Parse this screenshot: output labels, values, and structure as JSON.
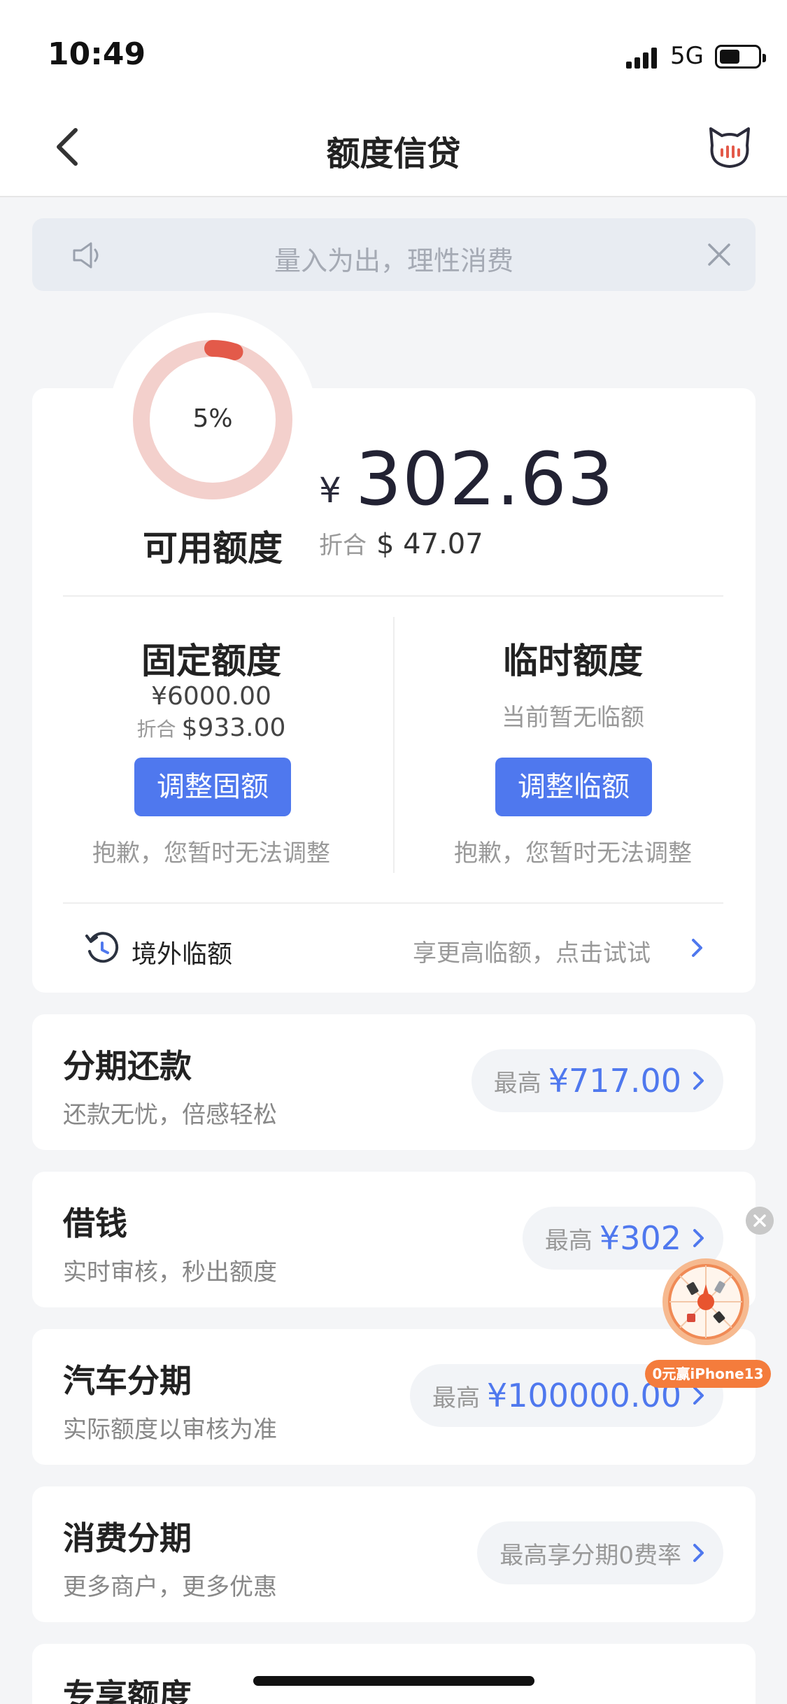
{
  "status_bar": {
    "time": "10:49",
    "network": "5G"
  },
  "nav": {
    "title": "额度信贷",
    "back_icon": "chevron-left-icon",
    "assistant_icon": "cat-mascot-icon"
  },
  "notice": {
    "text": "量入为出，理性消费",
    "icon": "speaker-icon"
  },
  "credit": {
    "usage_percent_label": "5%",
    "usage_fraction": 0.05,
    "available_label": "可用额度",
    "currency_symbol": "¥",
    "available_amount": "302.63",
    "converted_label": "折合",
    "converted_amount": "$ 47.07",
    "ring_color": "#e35a4a",
    "ring_track_color": "#f3d0cc"
  },
  "fixed_limit": {
    "title": "固定额度",
    "amount": "¥6000.00",
    "converted_label": "折合",
    "converted_amount": "$933.00",
    "button": "调整固额",
    "hint": "抱歉，您暂时无法调整"
  },
  "temp_limit": {
    "title": "临时额度",
    "status": "当前暂无临额",
    "button": "调整临额",
    "hint": "抱歉，您暂时无法调整"
  },
  "overseas": {
    "label": "境外临额",
    "hint": "享更高临额，点击试试"
  },
  "services": [
    {
      "title": "分期还款",
      "subtitle": "还款无忧，倍感轻松",
      "tag_label": "最高",
      "tag_value": "¥717.00"
    },
    {
      "title": "借钱",
      "subtitle": "实时审核，秒出额度",
      "tag_label": "最高",
      "tag_value": "¥302"
    },
    {
      "title": "汽车分期",
      "subtitle": "实际额度以审核为准",
      "tag_label": "最高",
      "tag_value": "¥100000.00"
    },
    {
      "title": "消费分期",
      "subtitle": "更多商户，更多优惠",
      "tag_text": "最高享分期0费率"
    },
    {
      "title": "专享额度"
    }
  ],
  "promo": {
    "label": "0元赢iPhone13"
  },
  "colors": {
    "accent": "#4f78ee",
    "background": "#f4f5f7"
  }
}
